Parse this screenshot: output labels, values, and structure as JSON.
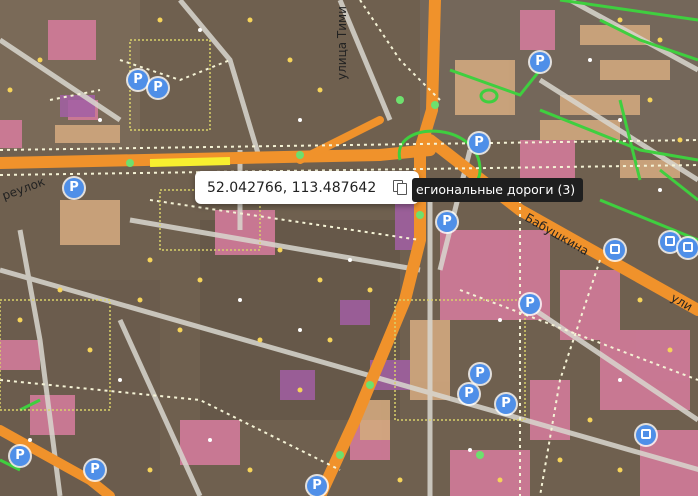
{
  "map": {
    "road_labels": {
      "street_top": "улица Тими",
      "street_left": "реулок",
      "street_right": "Бабушкина",
      "street_right_edge": "ули"
    },
    "icons": {
      "parking": "parking-icon",
      "bus": "bus-stop-icon",
      "copy": "copy-icon"
    },
    "colors": {
      "main_road": "#f0922b",
      "highlight_road": "#f7ef2f",
      "green_path": "#3fcf3f",
      "building": "#d67b9b",
      "parking_marker": "#4f8fe8"
    }
  },
  "coordinates_popup": {
    "value": "52.042766, 113.487642"
  },
  "tooltip": {
    "text": "егиональные дороги (3)"
  }
}
